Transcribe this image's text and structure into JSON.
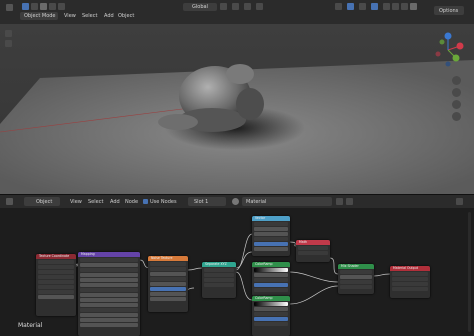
{
  "viewport_header": {
    "mode_label": "Object Mode",
    "menu": [
      "View",
      "Select",
      "Add",
      "Object"
    ],
    "transform_label": "Global",
    "options_label": "Options"
  },
  "node_header": {
    "editor_type_label": "Object",
    "menu": [
      "View",
      "Select",
      "Add",
      "Node"
    ],
    "use_nodes_label": "Use Nodes",
    "slot_label": "Slot 1",
    "material_name": "Material"
  },
  "node_editor": {
    "material_label": "Material",
    "nodes": [
      {
        "id": "texcoord",
        "title": "Texture Coordinate",
        "header_color": "#8b2a33"
      },
      {
        "id": "mapping",
        "title": "Mapping",
        "header_color": "#6443a8"
      },
      {
        "id": "noise",
        "title": "Noise Texture",
        "header_color": "#d77a3a"
      },
      {
        "id": "sepxyz",
        "title": "Separate XYZ",
        "header_color": "#2fa590"
      },
      {
        "id": "vector",
        "title": "Vector",
        "header_color": "#4ea0c8"
      },
      {
        "id": "math",
        "title": "Math",
        "header_color": "#c23a4a"
      },
      {
        "id": "colorramp1",
        "title": "ColorRamp",
        "header_color": "#2f8f4a"
      },
      {
        "id": "colorramp2",
        "title": "ColorRamp",
        "header_color": "#2f8f4a"
      },
      {
        "id": "mixshader",
        "title": "Mix Shader",
        "header_color": "#2f8f4a"
      },
      {
        "id": "output",
        "title": "Material Output",
        "header_color": "#b02f3a"
      }
    ]
  },
  "colors": {
    "accent_blue": "#4772b3",
    "axis_x": "#d13a4a",
    "axis_y": "#6aa83a",
    "axis_z": "#3a78d1"
  }
}
